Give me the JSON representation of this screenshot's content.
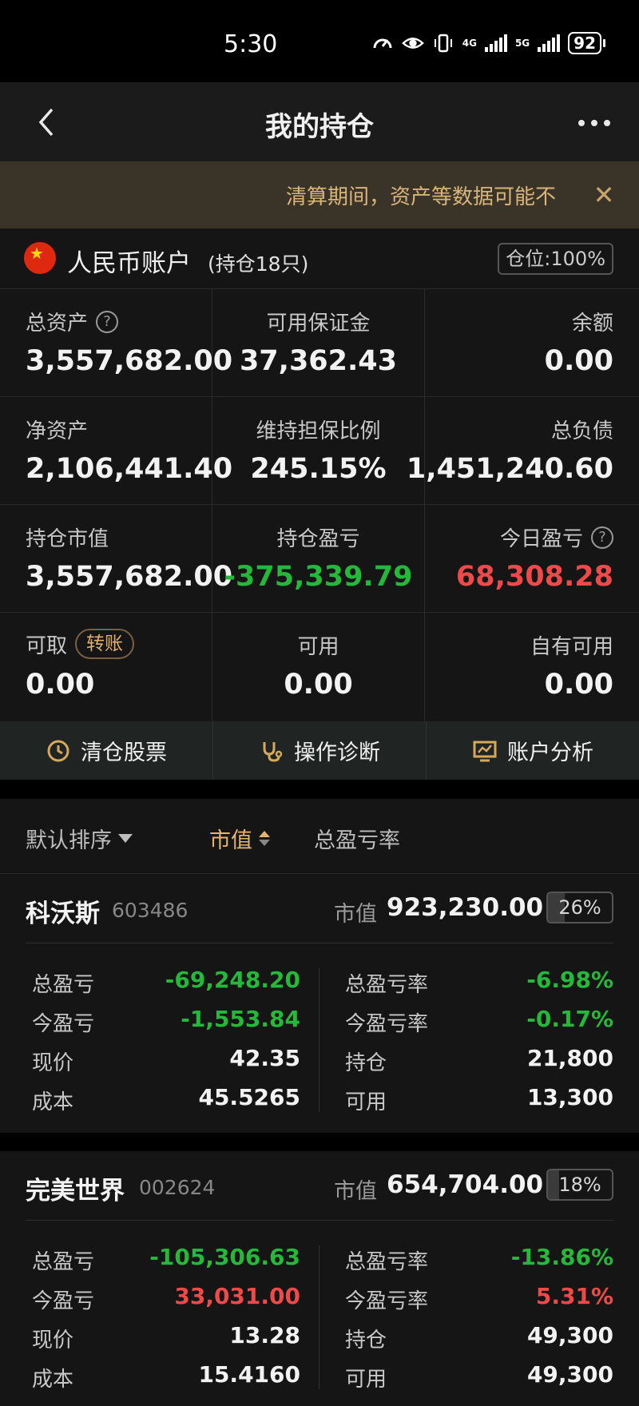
{
  "status_bar": {
    "time": "5:30",
    "net1": "4G",
    "net2": "5G",
    "battery": "92"
  },
  "header": {
    "title": "我的持仓"
  },
  "notice": {
    "text": "清算期间，资产等数据可能不"
  },
  "account": {
    "name": "人民币账户",
    "count": "(持仓18只)",
    "position": "仓位:100%"
  },
  "metrics": {
    "total_assets": {
      "label": "总资产",
      "value": "3,557,682.00"
    },
    "available_margin": {
      "label": "可用保证金",
      "value": "37,362.43"
    },
    "balance": {
      "label": "余额",
      "value": "0.00"
    },
    "net_assets": {
      "label": "净资产",
      "value": "2,106,441.40"
    },
    "maintenance_ratio": {
      "label": "维持担保比例",
      "value": "245.15%"
    },
    "total_liabilities": {
      "label": "总负债",
      "value": "1,451,240.60"
    },
    "position_value": {
      "label": "持仓市值",
      "value": "3,557,682.00"
    },
    "position_pnl": {
      "label": "持仓盈亏",
      "value": "-375,339.79"
    },
    "today_pnl": {
      "label": "今日盈亏",
      "value": "68,308.28"
    },
    "withdrawable": {
      "label": "可取",
      "value": "0.00",
      "button": "转账"
    },
    "available": {
      "label": "可用",
      "value": "0.00"
    },
    "own_available": {
      "label": "自有可用",
      "value": "0.00"
    }
  },
  "actions": {
    "clear": "清仓股票",
    "diagnose": "操作诊断",
    "analysis": "账户分析"
  },
  "sort": {
    "default": "默认排序",
    "market_value": "市值",
    "total_pnl_rate": "总盈亏率"
  },
  "stocks": [
    {
      "name": "科沃斯",
      "code": "603486",
      "mv_label": "市值",
      "market_value": "923,230.00",
      "ratio": "26%",
      "ratio_fraction": 0.26,
      "total_pnl_label": "总盈亏",
      "total_pnl": "-69,248.20",
      "total_pnl_rate_label": "总盈亏率",
      "total_pnl_rate": "-6.98%",
      "today_pnl_label": "今盈亏",
      "today_pnl": "-1,553.84",
      "today_pnl_rate_label": "今盈亏率",
      "today_pnl_rate": "-0.17%",
      "price_label": "现价",
      "price": "42.35",
      "holding_label": "持仓",
      "holding": "21,800",
      "cost_label": "成本",
      "cost": "45.5265",
      "avail_label": "可用",
      "avail": "13,300"
    },
    {
      "name": "完美世界",
      "code": "002624",
      "mv_label": "市值",
      "market_value": "654,704.00",
      "ratio": "18%",
      "ratio_fraction": 0.18,
      "total_pnl_label": "总盈亏",
      "total_pnl": "-105,306.63",
      "total_pnl_rate_label": "总盈亏率",
      "total_pnl_rate": "-13.86%",
      "today_pnl_label": "今盈亏",
      "today_pnl": "33,031.00",
      "today_pnl_rate_label": "今盈亏率",
      "today_pnl_rate": "5.31%",
      "price_label": "现价",
      "price": "13.28",
      "holding_label": "持仓",
      "holding": "49,300",
      "cost_label": "成本",
      "cost": "15.4160",
      "avail_label": "可用",
      "avail": "49,300"
    }
  ],
  "colors": {
    "gain": "#ef4a4a",
    "loss": "#25b83a",
    "accent": "#e3b56e"
  }
}
